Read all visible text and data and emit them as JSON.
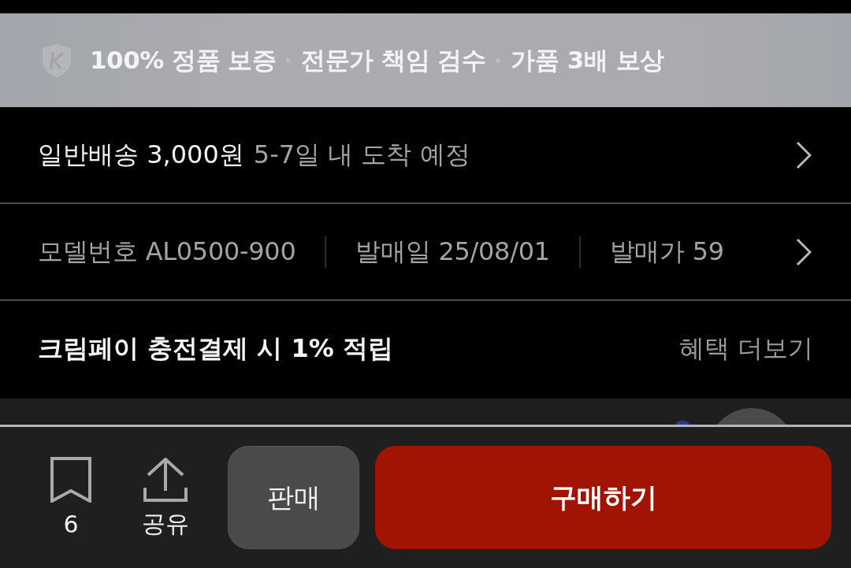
{
  "guarantee_banner": {
    "items": [
      "100% 정품 보증",
      "전문가 책임 검수",
      "가품 3배 보상"
    ]
  },
  "delivery_row": {
    "label": "일반배송 3,000원",
    "detail": "5-7일 내 도착 예정"
  },
  "product_info_row": {
    "items": [
      "모델번호 AL0500-900",
      "발매일 25/08/01",
      "발매가 59"
    ]
  },
  "benefit_row": {
    "label": "크림페이 충전결제 시 1% 적립",
    "link": "혜택 더보기"
  },
  "bottom_bar": {
    "bookmark": {
      "count": "6"
    },
    "share": {
      "label": "공유"
    },
    "buttons": [
      {
        "label": "판매",
        "kind": "sell"
      },
      {
        "label": "구매하기",
        "kind": "buy"
      }
    ]
  }
}
